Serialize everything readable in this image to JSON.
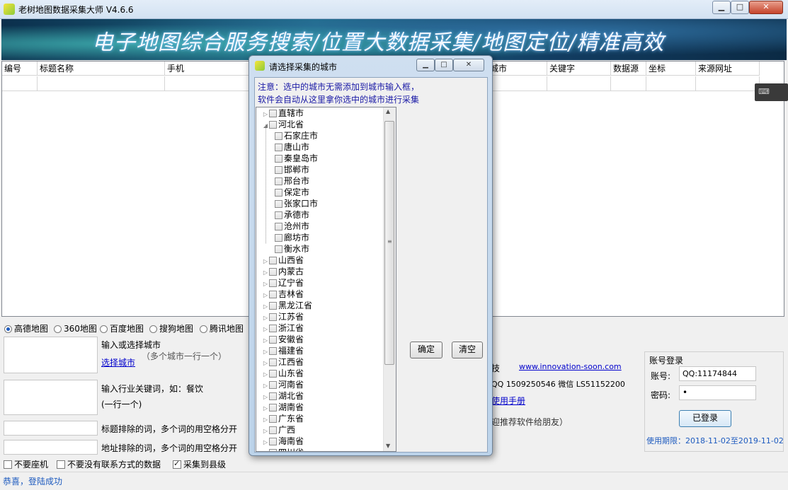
{
  "window": {
    "title": "老树地图数据采集大师 V4.6.6",
    "min_glyph": "▁",
    "max_glyph": "□",
    "close_glyph": "✕"
  },
  "banner": {
    "text": "电子地图综合服务搜索/位置大数据采集/地图定位/精准高效"
  },
  "grid": {
    "columns_left": [
      "编号",
      "标题名称",
      "手机"
    ],
    "columns_right": [
      "城市",
      "关键字",
      "数据源",
      "坐标",
      "来源网址"
    ]
  },
  "map_sources": [
    {
      "label": "高德地图",
      "selected": true
    },
    {
      "label": "360地图",
      "selected": false
    },
    {
      "label": "百度地图",
      "selected": false
    },
    {
      "label": "搜狗地图",
      "selected": false
    },
    {
      "label": "腾讯地图",
      "selected": false
    }
  ],
  "city_input": {
    "label": "输入或选择城市",
    "hint": "（多个城市一行一个）",
    "select_link": "选择城市"
  },
  "keyword_input": {
    "label": "输入行业关键词，如：餐饮",
    "hint": "(一行一个)"
  },
  "exclude": {
    "title_label": "标题排除的词，多个词的用空格分开",
    "address_label": "地址排除的词，多个词的用空格分开"
  },
  "options": [
    {
      "label": "不要座机",
      "checked": false
    },
    {
      "label": "不要没有联系方式的数据",
      "checked": false
    },
    {
      "label": "采集到县级",
      "checked": true
    }
  ],
  "info": {
    "company": "技",
    "website": "www.innovation-soon.com",
    "contact": "QQ 1509250546  微信 LS51152200",
    "manual": "使用手册",
    "recommend": "迎推荐软件给朋友）"
  },
  "login": {
    "title": "账号登录",
    "account_label": "账号:",
    "account_value": "QQ:11174844",
    "password_label": "密码:",
    "password_value": "•",
    "button": "已登录",
    "validity": "使用期限：2018-11-02至2019-11-02"
  },
  "status": {
    "text": "恭喜，登陆成功"
  },
  "dialog": {
    "title": "请选择采集的城市",
    "note_line1": "注意：选中的城市无需添加到城市输入框，",
    "note_line2": "软件会自动从这里拿你选中的城市进行采集",
    "confirm": "确定",
    "clear": "清空",
    "tree": [
      {
        "label": "直辖市",
        "level": 0,
        "expanded": false
      },
      {
        "label": "河北省",
        "level": 0,
        "expanded": true
      },
      {
        "label": "石家庄市",
        "level": 1
      },
      {
        "label": "唐山市",
        "level": 1
      },
      {
        "label": "秦皇岛市",
        "level": 1
      },
      {
        "label": "邯郸市",
        "level": 1
      },
      {
        "label": "邢台市",
        "level": 1
      },
      {
        "label": "保定市",
        "level": 1
      },
      {
        "label": "张家口市",
        "level": 1
      },
      {
        "label": "承德市",
        "level": 1
      },
      {
        "label": "沧州市",
        "level": 1
      },
      {
        "label": "廊坊市",
        "level": 1
      },
      {
        "label": "衡水市",
        "level": 1
      },
      {
        "label": "山西省",
        "level": 0,
        "expanded": false
      },
      {
        "label": "内蒙古",
        "level": 0,
        "expanded": false
      },
      {
        "label": "辽宁省",
        "level": 0,
        "expanded": false
      },
      {
        "label": "吉林省",
        "level": 0,
        "expanded": false
      },
      {
        "label": "黑龙江省",
        "level": 0,
        "expanded": false
      },
      {
        "label": "江苏省",
        "level": 0,
        "expanded": false
      },
      {
        "label": "浙江省",
        "level": 0,
        "expanded": false
      },
      {
        "label": "安徽省",
        "level": 0,
        "expanded": false
      },
      {
        "label": "福建省",
        "level": 0,
        "expanded": false
      },
      {
        "label": "江西省",
        "level": 0,
        "expanded": false
      },
      {
        "label": "山东省",
        "level": 0,
        "expanded": false
      },
      {
        "label": "河南省",
        "level": 0,
        "expanded": false
      },
      {
        "label": "湖北省",
        "level": 0,
        "expanded": false
      },
      {
        "label": "湖南省",
        "level": 0,
        "expanded": false
      },
      {
        "label": "广东省",
        "level": 0,
        "expanded": false
      },
      {
        "label": "广西",
        "level": 0,
        "expanded": false
      },
      {
        "label": "海南省",
        "level": 0,
        "expanded": false
      },
      {
        "label": "四川省",
        "level": 0,
        "expanded": false
      }
    ]
  }
}
